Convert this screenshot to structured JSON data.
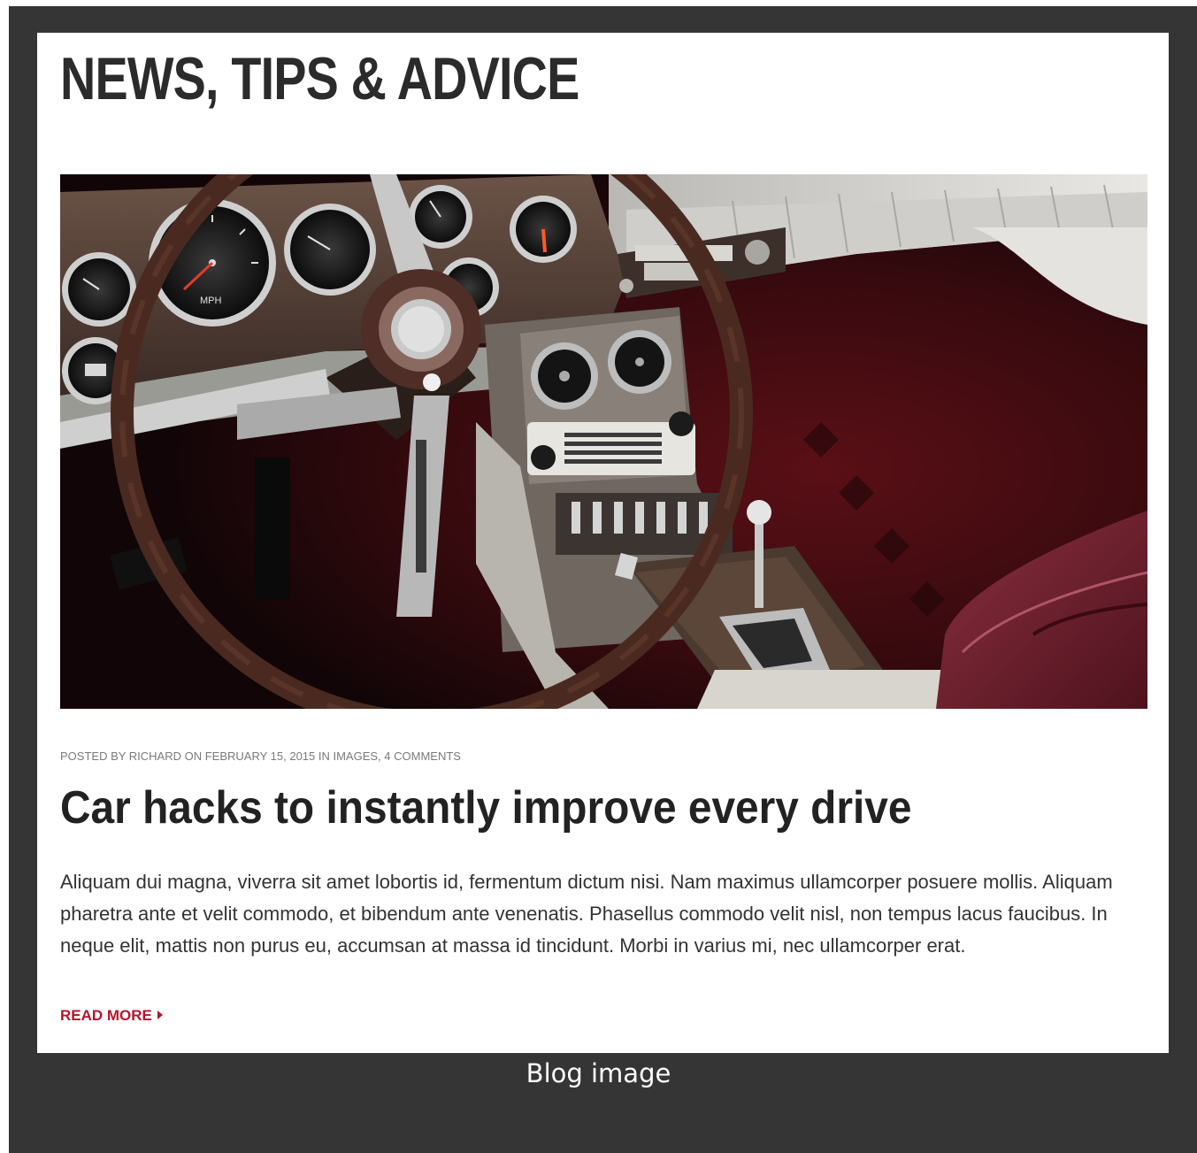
{
  "section": {
    "heading": "NEWS, TIPS & ADVICE"
  },
  "post": {
    "meta": {
      "posted_by": "POSTED BY RICHARD ON FEBRUARY 15, 2015 IN IMAGES, 4 COMMENTS"
    },
    "title": "Car hacks to instantly improve every drive",
    "excerpt": "Aliquam dui magna, viverra sit amet lobortis id, fermentum dictum nisi. Nam maximus ullamcorper posuere mollis. Aliquam pharetra ante et velit commodo, et bibendum ante venenatis. Phasellus commodo velit nisl, non tempus lacus faucibus. In neque elit, mattis non purus eu, accumsan at massa id tincidunt. Morbi in varius mi, nec ullamcorper erat.",
    "read_more": "READ MORE",
    "image": {
      "subject": "classic car interior with steering wheel and dashboard",
      "speedometer_label": "MPH"
    }
  },
  "caption": "Blog image",
  "colors": {
    "frame": "#353535",
    "panel": "#ffffff",
    "heading": "#2b2b2b",
    "meta": "#7a7a7a",
    "accent": "#b3162b"
  }
}
